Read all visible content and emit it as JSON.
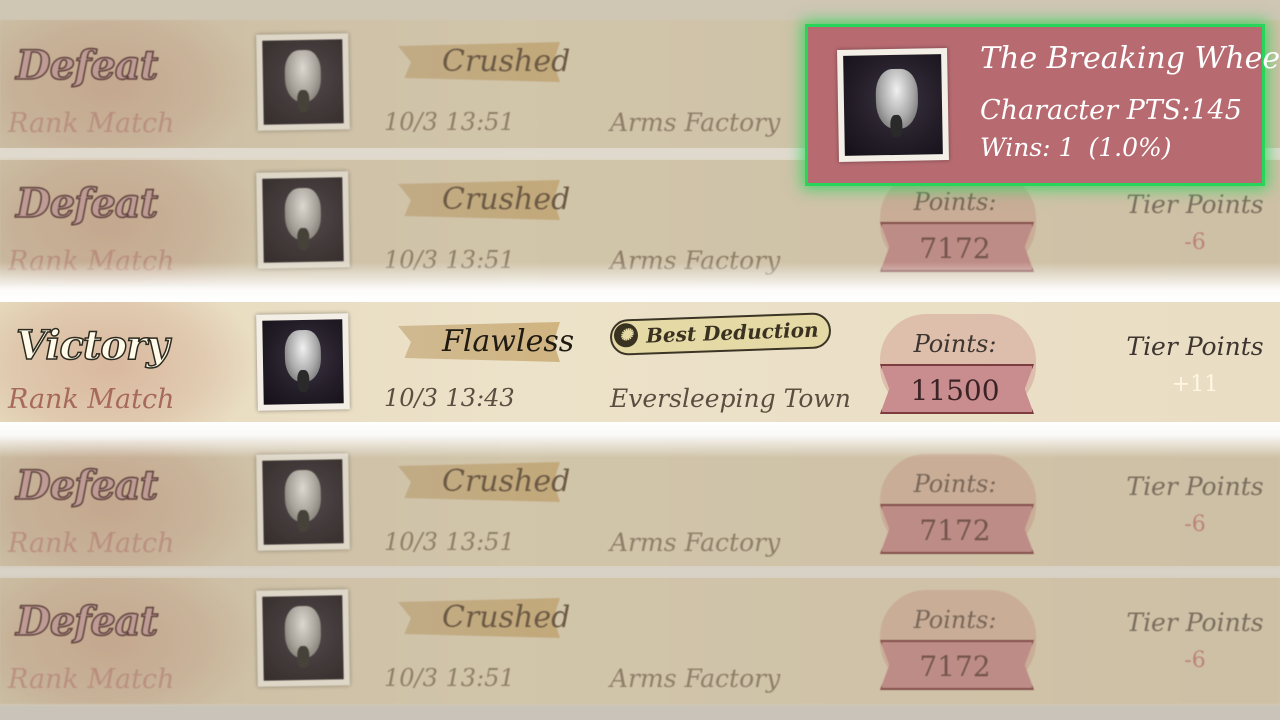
{
  "records": [
    {
      "result": "Defeat",
      "mode": "Rank Match",
      "verdict": "Crushed",
      "time": "10/3 13:51",
      "map": "Arms Factory",
      "points_label": "",
      "points": "",
      "tier_label": "",
      "tier": ""
    },
    {
      "result": "Defeat",
      "mode": "Rank Match",
      "verdict": "Crushed",
      "time": "10/3 13:51",
      "map": "Arms Factory",
      "points_label": "Points:",
      "points": "7172",
      "tier_label": "Tier Points",
      "tier": "-6"
    },
    {
      "result": "Victory",
      "mode": "Rank Match",
      "verdict": "Flawless",
      "badge": "Best Deduction",
      "time": "10/3 13:43",
      "map": "Eversleeping Town",
      "points_label": "Points:",
      "points": "11500",
      "tier_label": "Tier Points",
      "tier": "+11"
    },
    {
      "result": "Defeat",
      "mode": "Rank Match",
      "verdict": "Crushed",
      "time": "10/3 13:51",
      "map": "Arms Factory",
      "points_label": "Points:",
      "points": "7172",
      "tier_label": "Tier Points",
      "tier": "-6"
    },
    {
      "result": "Defeat",
      "mode": "Rank Match",
      "verdict": "Crushed",
      "time": "10/3 13:51",
      "map": "Arms Factory",
      "points_label": "Points:",
      "points": "7172",
      "tier_label": "Tier Points",
      "tier": "-6"
    }
  ],
  "tooltip": {
    "name": "The Breaking Wheel",
    "pts": "Character PTS:145",
    "wins": "Wins: 1",
    "rate": "(1.0%)"
  },
  "colors": {
    "highlight_border": "#28d45a",
    "tooltip_bg": "#b76b71",
    "points_box": "#c98d8f"
  },
  "icons": {
    "avatar": "hunter-portrait-icon",
    "badge": "film-reel-icon"
  }
}
